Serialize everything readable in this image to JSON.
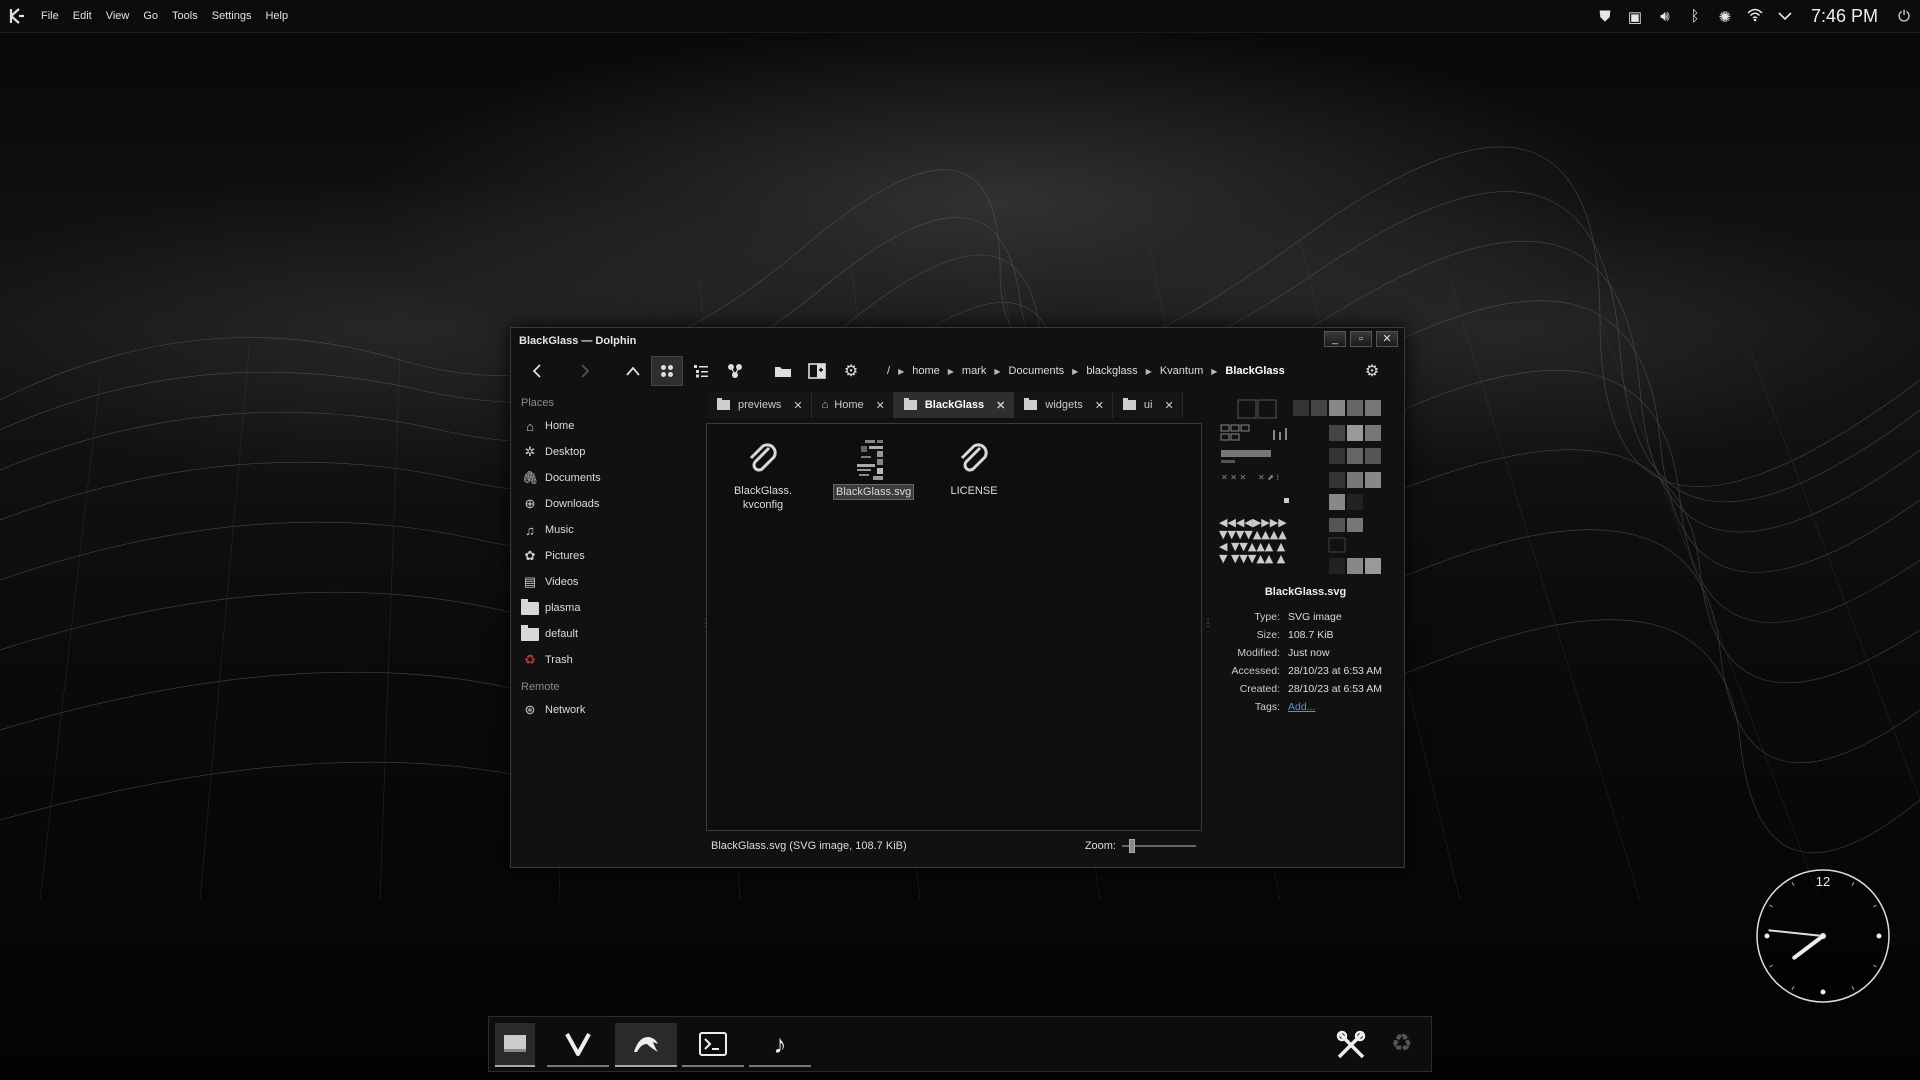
{
  "global_menu": [
    "File",
    "Edit",
    "View",
    "Go",
    "Tools",
    "Settings",
    "Help"
  ],
  "system_tray": {
    "clock": "7:46 PM"
  },
  "window": {
    "title": "BlackGlass — Dolphin"
  },
  "breadcrumb": {
    "root": "/",
    "parts": [
      "home",
      "mark",
      "Documents",
      "blackglass",
      "Kvantum"
    ],
    "current": "BlackGlass"
  },
  "places": {
    "places_header": "Places",
    "items": [
      "Home",
      "Desktop",
      "Documents",
      "Downloads",
      "Music",
      "Pictures",
      "Videos",
      "plasma",
      "default",
      "Trash"
    ],
    "remote_header": "Remote",
    "remote_items": [
      "Network"
    ]
  },
  "tabs": [
    "previews",
    "Home",
    "BlackGlass",
    "widgets",
    "ui"
  ],
  "active_tab": "BlackGlass",
  "files": [
    {
      "line1": "BlackGlass.",
      "line2": "kvconfig"
    },
    {
      "line1": "BlackGlass.svg",
      "line2": ""
    },
    {
      "line1": "LICENSE",
      "line2": ""
    }
  ],
  "status": {
    "text": "BlackGlass.svg (SVG image, 108.7 KiB)",
    "zoom_label": "Zoom:",
    "zoom_fraction": 0.1
  },
  "info_panel": {
    "filename": "BlackGlass.svg",
    "type_label": "Type:",
    "type": "SVG image",
    "size_label": "Size:",
    "size": "108.7 KiB",
    "modified_label": "Modified:",
    "modified": "Just now",
    "accessed_label": "Accessed:",
    "accessed": "28/10/23 at 6:53 AM",
    "created_label": "Created:",
    "created": "28/10/23 at 6:53 AM",
    "tags_label": "Tags:",
    "tags_link": "Add..."
  },
  "analog_clock": {
    "numeral": "12",
    "hour": 7,
    "minute": 46
  },
  "colors": {
    "accent_link": "#5b8fd9",
    "trash_icon": "#cc3333",
    "background": "#050505"
  }
}
